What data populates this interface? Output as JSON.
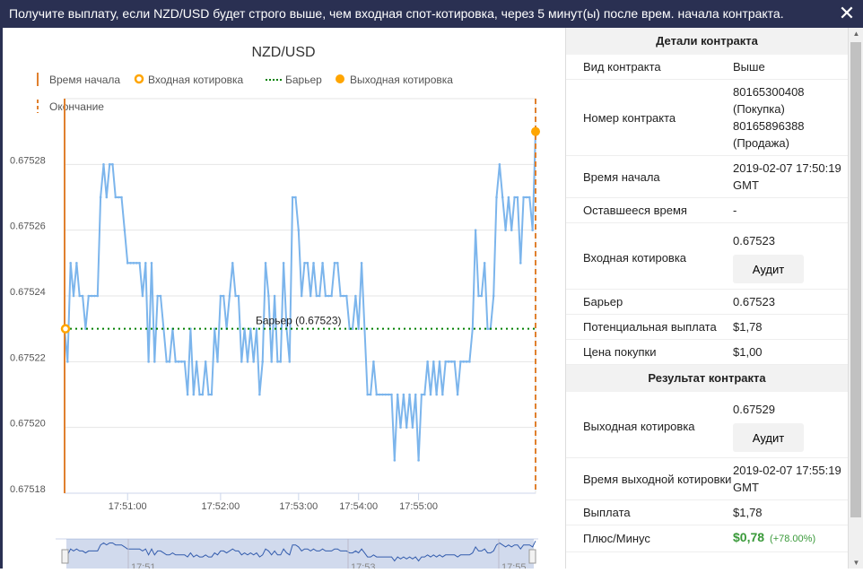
{
  "banner": {
    "text": "Получите выплату, если NZD/USD будет строго выше, чем входная спот-котировка, через 5 минут(ы) после врем. начала контракта.",
    "close": "✕"
  },
  "chart_data": {
    "type": "line",
    "title": "NZD/USD",
    "legend": [
      "Время начала",
      "Входная котировка",
      "Барьер",
      "Выходная котировка",
      "Окончание"
    ],
    "yticks": [
      "0.67518",
      "0.67520",
      "0.67522",
      "0.67524",
      "0.67526",
      "0.67528"
    ],
    "ylim": [
      0.67518,
      0.6753
    ],
    "xtick_labels": [
      {
        "label": "17:51:00",
        "index": 21
      },
      {
        "label": "17:52:00",
        "index": 52
      },
      {
        "label": "17:53:00",
        "index": 78
      },
      {
        "label": "17:54:00",
        "index": 98
      },
      {
        "label": "17:55:00",
        "index": 118
      }
    ],
    "barrier": 0.67523,
    "barrier_label": "Барьер (0.67523)",
    "entry": 0.67523,
    "exit": 0.67529,
    "values": [
      23,
      22,
      25,
      24,
      25,
      24,
      24,
      23,
      24,
      24,
      24,
      24,
      27,
      28,
      27,
      28,
      28,
      27,
      27,
      27,
      26,
      25,
      25,
      25,
      25,
      25,
      24,
      25,
      22,
      25,
      22,
      24,
      24,
      23,
      22,
      22,
      23,
      22,
      22,
      22,
      22,
      21,
      23,
      21,
      22,
      21,
      21,
      22,
      21,
      21,
      23,
      22,
      24,
      24,
      23,
      24,
      25,
      24,
      24,
      22,
      23,
      22,
      23,
      22,
      23,
      21,
      22,
      25,
      24,
      22,
      24,
      22,
      22,
      25,
      23,
      22,
      27,
      27,
      26,
      24,
      25,
      25,
      24,
      25,
      24,
      24,
      25,
      24,
      24,
      24,
      25,
      25,
      24,
      24,
      24,
      23,
      23,
      24,
      23,
      25,
      23,
      21,
      21,
      22,
      21,
      21,
      21,
      21,
      21,
      21,
      19,
      21,
      20,
      21,
      20,
      21,
      20,
      21,
      19,
      21,
      21,
      22,
      21,
      22,
      21,
      22,
      21,
      22,
      22,
      22,
      22,
      21,
      22,
      22,
      22,
      22,
      23,
      26,
      24,
      24,
      25,
      23,
      23,
      24,
      27,
      28,
      27,
      26,
      27,
      26,
      27,
      27,
      25,
      27,
      27,
      27,
      26,
      29
    ],
    "navigator_labels": [
      "17:51",
      "17:53",
      "17:55"
    ]
  },
  "panel": {
    "details_title": "Детали контракта",
    "rows": [
      {
        "k": "Вид контракта",
        "v": "Выше"
      },
      {
        "k": "Номер контракта",
        "v": "80165300408 (Покупка) 80165896388 (Продажа)"
      },
      {
        "k": "Время начала",
        "v": "2019-02-07 17:50:19 GMT"
      },
      {
        "k": "Оставшееся время",
        "v": "-"
      },
      {
        "k": "Входная котировка",
        "v": "0.67523",
        "btn": "Аудит"
      },
      {
        "k": "Барьер",
        "v": "0.67523"
      },
      {
        "k": "Потенциальная выплата",
        "v": "$1,78"
      },
      {
        "k": "Цена покупки",
        "v": "$1,00"
      }
    ],
    "result_title": "Результат контракта",
    "rows2": [
      {
        "k": "Выходная котировка",
        "v": "0.67529",
        "btn": "Аудит"
      },
      {
        "k": "Время выходной котировки",
        "v": "2019-02-07 17:55:19 GMT"
      },
      {
        "k": "Выплата",
        "v": "$1,78"
      },
      {
        "k": "Плюс/Минус",
        "v": "$0,78",
        "pct": "(+78.00%)"
      }
    ]
  },
  "colors": {
    "line": "#7cb5ec",
    "barrier": "#008000",
    "marker": "#ffa500",
    "vline": "#e0802e",
    "banner": "#2a3052"
  }
}
